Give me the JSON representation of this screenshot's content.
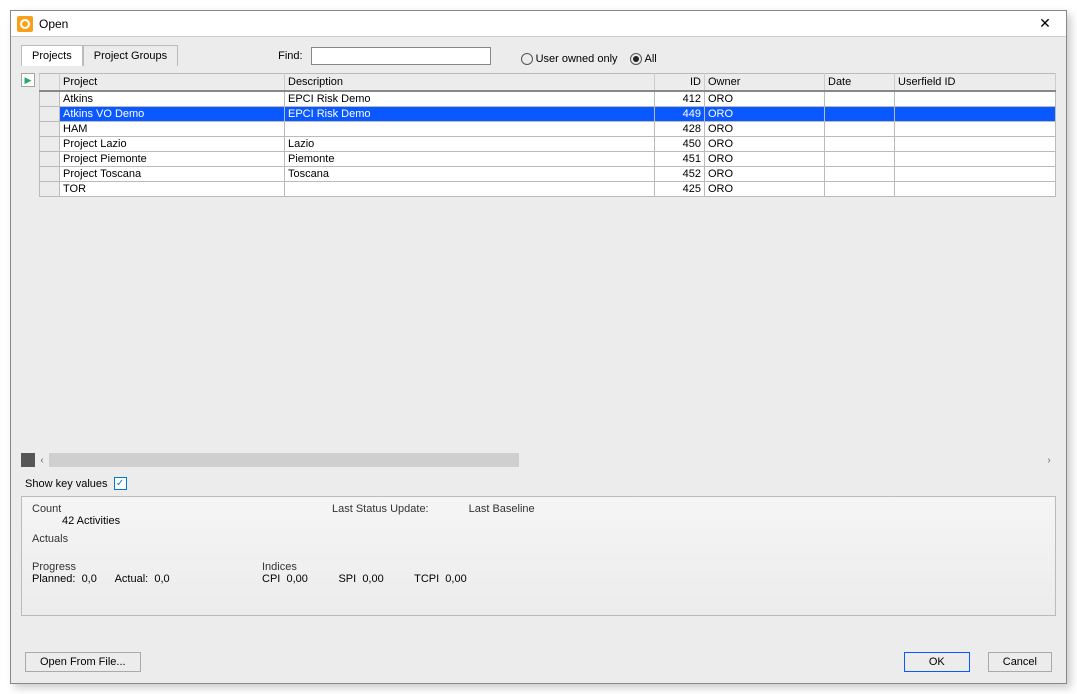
{
  "window": {
    "title": "Open"
  },
  "tabs": {
    "projects": "Projects",
    "groups": "Project Groups"
  },
  "find": {
    "label": "Find:",
    "value": ""
  },
  "filter": {
    "user_only": "User owned only",
    "all": "All",
    "selected": "all"
  },
  "columns": {
    "project": "Project",
    "description": "Description",
    "id": "ID",
    "owner": "Owner",
    "date": "Date",
    "userfield": "Userfield ID"
  },
  "rows": [
    {
      "project": "Atkins",
      "description": "EPCI Risk Demo",
      "id": "412",
      "owner": "ORO",
      "date": "",
      "userfield": "",
      "selected": false
    },
    {
      "project": "Atkins VO Demo",
      "description": "EPCI Risk Demo",
      "id": "449",
      "owner": "ORO",
      "date": "",
      "userfield": "",
      "selected": true
    },
    {
      "project": "HAM",
      "description": "",
      "id": "428",
      "owner": "ORO",
      "date": "",
      "userfield": "",
      "selected": false
    },
    {
      "project": "Project Lazio",
      "description": "Lazio",
      "id": "450",
      "owner": "ORO",
      "date": "",
      "userfield": "",
      "selected": false
    },
    {
      "project": "Project Piemonte",
      "description": "Piemonte",
      "id": "451",
      "owner": "ORO",
      "date": "",
      "userfield": "",
      "selected": false
    },
    {
      "project": "Project Toscana",
      "description": "Toscana",
      "id": "452",
      "owner": "ORO",
      "date": "",
      "userfield": "",
      "selected": false
    },
    {
      "project": "TOR",
      "description": "",
      "id": "425",
      "owner": "ORO",
      "date": "",
      "userfield": "",
      "selected": false
    }
  ],
  "skv": {
    "label": "Show key values",
    "checked": true
  },
  "panel": {
    "count_label": "Count",
    "count_value": "42 Activities",
    "last_status": "Last Status Update:",
    "last_baseline": "Last Baseline",
    "actuals": "Actuals",
    "progress": "Progress",
    "planned_label": "Planned:",
    "planned_val": "0,0",
    "actual_label": "Actual:",
    "actual_val": "0,0",
    "indices": "Indices",
    "cpi_label": "CPI",
    "cpi_val": "0,00",
    "spi_label": "SPI",
    "spi_val": "0,00",
    "tcpi_label": "TCPI",
    "tcpi_val": "0,00"
  },
  "buttons": {
    "open_file": "Open From File...",
    "ok": "OK",
    "cancel": "Cancel"
  }
}
